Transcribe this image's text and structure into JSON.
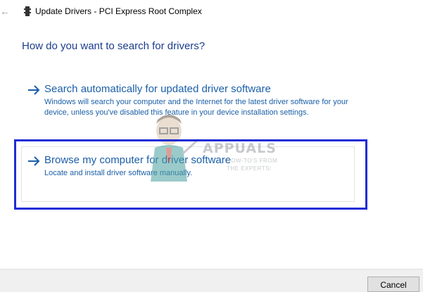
{
  "window": {
    "title": "Update Drivers - PCI Express Root Complex",
    "back_icon": "back-arrow-icon",
    "device_icon": "device-icon"
  },
  "main": {
    "heading": "How do you want to search for drivers?",
    "options": [
      {
        "title": "Search automatically for updated driver software",
        "description": "Windows will search your computer and the Internet for the latest driver software for your device, unless you've disabled this feature in your device installation settings.",
        "icon": "right-arrow-icon"
      },
      {
        "title": "Browse my computer for driver software",
        "description": "Locate and install driver software manually.",
        "icon": "right-arrow-icon"
      }
    ]
  },
  "watermark": {
    "name": "APPUALS",
    "tagline_1": "HOW-TO'S FROM",
    "tagline_2": "THE EXPERTS!"
  },
  "footer": {
    "cancel_label": "Cancel"
  },
  "colors": {
    "link_blue": "#1b5fa8",
    "heading_blue": "#1c3c8c",
    "highlight_frame": "#1e2dd6"
  }
}
